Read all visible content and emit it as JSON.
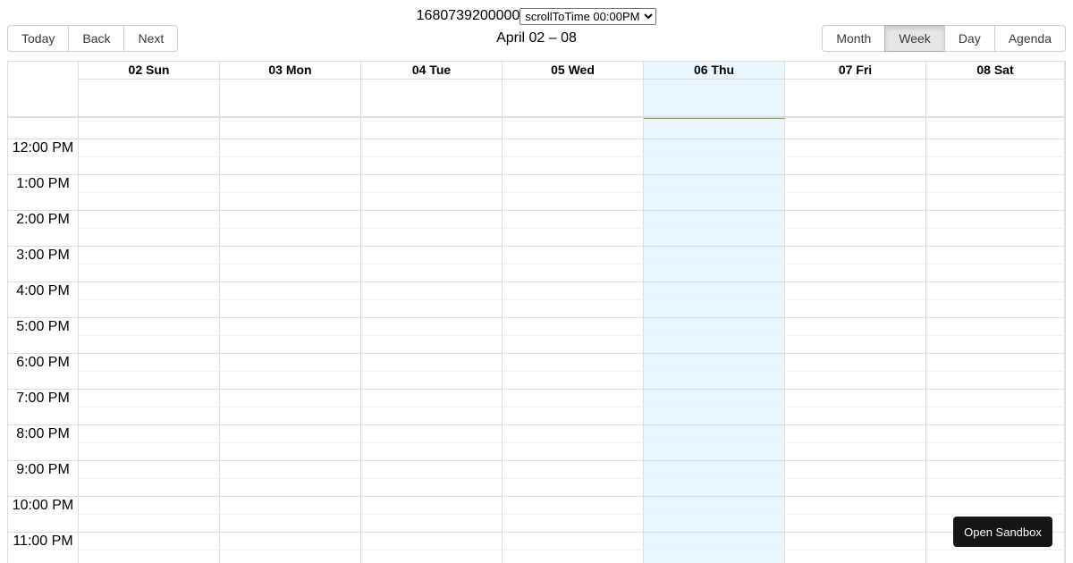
{
  "top": {
    "timestamp": "1680739200000",
    "select_value": "scrollToTime 00:00PM",
    "select_options": [
      "scrollToTime 00:00PM"
    ]
  },
  "toolbar": {
    "nav": [
      "Today",
      "Back",
      "Next"
    ],
    "label": "April 02 – 08",
    "views": [
      "Month",
      "Week",
      "Day",
      "Agenda"
    ],
    "active_view": "Week"
  },
  "days": [
    {
      "label": "02 Sun",
      "today": false
    },
    {
      "label": "03 Mon",
      "today": false
    },
    {
      "label": "04 Tue",
      "today": false
    },
    {
      "label": "05 Wed",
      "today": false
    },
    {
      "label": "06 Thu",
      "today": true
    },
    {
      "label": "07 Fri",
      "today": false
    },
    {
      "label": "08 Sat",
      "today": false
    }
  ],
  "time_slots": [
    "12:00 PM",
    "1:00 PM",
    "2:00 PM",
    "3:00 PM",
    "4:00 PM",
    "5:00 PM",
    "6:00 PM",
    "7:00 PM",
    "8:00 PM",
    "9:00 PM",
    "10:00 PM",
    "11:00 PM"
  ],
  "sandbox_button": "Open Sandbox",
  "colors": {
    "today_bg": "#eaf6ff",
    "now_indicator": "#74ad31",
    "sandbox_bg": "#151515",
    "active_button_bg": "#e6e6e6"
  }
}
